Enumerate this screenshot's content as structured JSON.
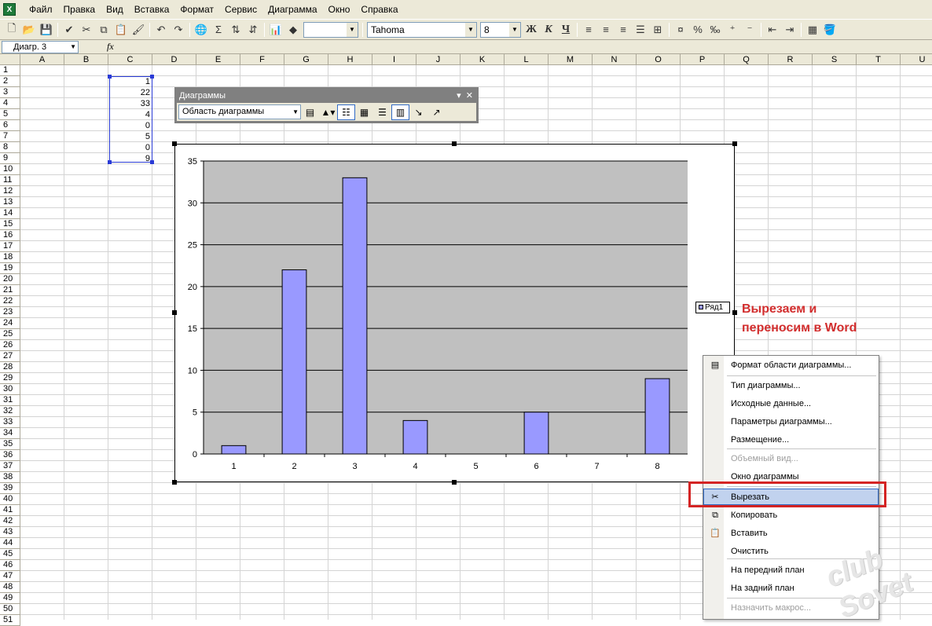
{
  "menu": [
    "Файл",
    "Правка",
    "Вид",
    "Вставка",
    "Формат",
    "Сервис",
    "Диаграмма",
    "Окно",
    "Справка"
  ],
  "toolbar": {
    "font_name": "Tahoma",
    "font_size": "8",
    "bold": "Ж",
    "italic": "К",
    "underline": "Ч"
  },
  "formula_bar": {
    "name_box": "Диагр. 3",
    "fx_label": "fx"
  },
  "columns": [
    "A",
    "B",
    "C",
    "D",
    "E",
    "F",
    "G",
    "H",
    "I",
    "J",
    "K",
    "L",
    "M",
    "N",
    "O",
    "P",
    "Q",
    "R",
    "S",
    "T",
    "U"
  ],
  "rows": [
    "1",
    "2",
    "3",
    "4",
    "5",
    "6",
    "7",
    "8",
    "9",
    "10",
    "11",
    "12",
    "13",
    "14",
    "15",
    "16",
    "17",
    "18",
    "19",
    "20",
    "21",
    "22",
    "23",
    "24",
    "25",
    "26",
    "27",
    "28",
    "29",
    "30",
    "31",
    "32",
    "33",
    "34",
    "35",
    "36",
    "37",
    "38",
    "39",
    "40",
    "41",
    "42",
    "43",
    "44",
    "45",
    "46",
    "47",
    "48",
    "49",
    "50",
    "51"
  ],
  "cell_values": [
    "1",
    "22",
    "33",
    "4",
    "0",
    "5",
    "0",
    "9"
  ],
  "chart_toolbar": {
    "title": "Диаграммы",
    "combo_value": "Область диаграммы"
  },
  "chart_data": {
    "type": "bar",
    "categories": [
      "1",
      "2",
      "3",
      "4",
      "5",
      "6",
      "7",
      "8"
    ],
    "series": [
      {
        "name": "Ряд1",
        "values": [
          1,
          22,
          33,
          4,
          0,
          5,
          0,
          9
        ]
      }
    ],
    "ylim": [
      0,
      35
    ],
    "yticks": [
      "0",
      "5",
      "10",
      "15",
      "20",
      "25",
      "30",
      "35"
    ],
    "title": "",
    "xlabel": "",
    "ylabel": "",
    "grid": true,
    "legend_position": "right",
    "bar_color": "#9999ff",
    "plot_background": "#c0c0c0"
  },
  "annotation": {
    "line1": "Вырезаем и",
    "line2": "переносим в Word",
    "color": "#d22e2e"
  },
  "context_menu": {
    "items": [
      {
        "label": "Формат области диаграммы...",
        "icon": "format-icon",
        "disabled": false
      },
      {
        "label": "Тип диаграммы...",
        "icon": "",
        "disabled": false
      },
      {
        "label": "Исходные данные...",
        "icon": "",
        "disabled": false
      },
      {
        "label": "Параметры диаграммы...",
        "icon": "",
        "disabled": false
      },
      {
        "label": "Размещение...",
        "icon": "",
        "disabled": false
      },
      {
        "label": "Объемный вид...",
        "icon": "",
        "disabled": true
      },
      {
        "label": "Окно диаграммы",
        "icon": "",
        "disabled": false
      },
      {
        "label": "Вырезать",
        "icon": "scissors-icon",
        "disabled": false,
        "highlighted": true
      },
      {
        "label": "Копировать",
        "icon": "copy-icon",
        "disabled": false
      },
      {
        "label": "Вставить",
        "icon": "paste-icon",
        "disabled": false
      },
      {
        "label": "Очистить",
        "icon": "",
        "disabled": false
      },
      {
        "label": "На передний план",
        "icon": "",
        "disabled": false
      },
      {
        "label": "На задний план",
        "icon": "",
        "disabled": false
      },
      {
        "label": "Назначить макрос...",
        "icon": "",
        "disabled": true
      }
    ]
  },
  "watermark": "club Sovet"
}
